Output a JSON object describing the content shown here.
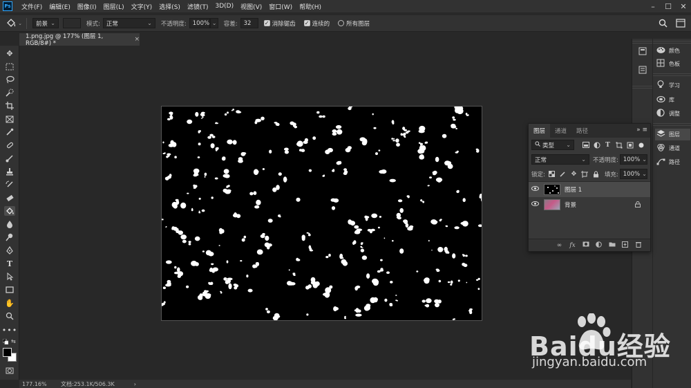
{
  "menubar": {
    "logo": "Ps",
    "items": [
      "文件(F)",
      "编辑(E)",
      "图像(I)",
      "图层(L)",
      "文字(Y)",
      "选择(S)",
      "滤镜(T)",
      "3D(D)",
      "视图(V)",
      "窗口(W)",
      "帮助(H)"
    ],
    "window_controls": [
      "–",
      "☐",
      "✕"
    ]
  },
  "options": {
    "fill_source": "前景",
    "mode_label": "模式:",
    "mode_value": "正常",
    "opacity_label": "不透明度:",
    "opacity_value": "100%",
    "tolerance_label": "容差:",
    "tolerance_value": "32",
    "antialias_label": "消除锯齿",
    "antialias_checked": true,
    "contiguous_label": "连续的",
    "contiguous_checked": true,
    "all_layers_label": "所有图层",
    "all_layers_checked": false
  },
  "document": {
    "tab_title": "1.png.jpg @ 177% (图层 1, RGB/8#) *",
    "close_glyph": "×"
  },
  "status": {
    "zoom": "177.16%",
    "doc_info": "文档:253.1K/506.3K",
    "arrow": "›"
  },
  "right_panels": [
    {
      "label": "颜色",
      "icon": "palette-icon"
    },
    {
      "label": "色板",
      "icon": "swatches-icon"
    },
    {
      "label": "学习",
      "icon": "learn-bulb-icon"
    },
    {
      "label": "库",
      "icon": "libraries-icon"
    },
    {
      "label": "调整",
      "icon": "adjustments-icon"
    },
    {
      "label": "图层",
      "icon": "layers-icon",
      "active": true
    },
    {
      "label": "通道",
      "icon": "channels-icon"
    },
    {
      "label": "路径",
      "icon": "paths-icon"
    }
  ],
  "layers_panel": {
    "tabs": [
      "图层",
      "通道",
      "路径"
    ],
    "active_tab": "图层",
    "filter_value": "类型",
    "blend_mode": "正常",
    "opacity_label": "不透明度:",
    "opacity_value": "100%",
    "lock_label": "锁定:",
    "fill_label": "填充:",
    "fill_value": "100%",
    "layers": [
      {
        "name": "图层 1",
        "visible": true,
        "selected": true,
        "locked": false
      },
      {
        "name": "背景",
        "visible": true,
        "selected": false,
        "locked": true
      }
    ]
  },
  "watermark": {
    "brand": "Baidu经验",
    "url": "jingyan.baidu.com"
  },
  "colors": {
    "foreground": "#000000",
    "background": "#ffffff",
    "ps_blue": "#31a8ff"
  }
}
